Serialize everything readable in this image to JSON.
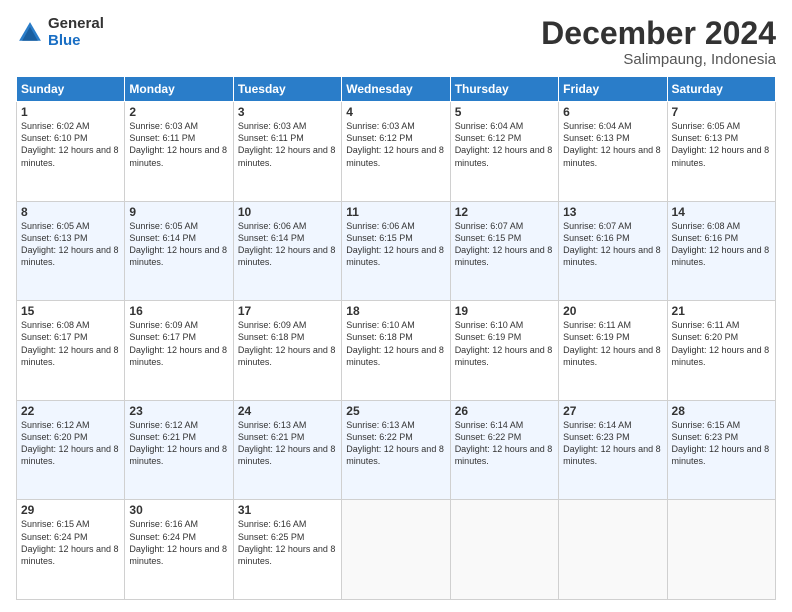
{
  "logo": {
    "general": "General",
    "blue": "Blue"
  },
  "title": "December 2024",
  "location": "Salimpaung, Indonesia",
  "days_of_week": [
    "Sunday",
    "Monday",
    "Tuesday",
    "Wednesday",
    "Thursday",
    "Friday",
    "Saturday"
  ],
  "weeks": [
    [
      {
        "day": "1",
        "sunrise": "6:02 AM",
        "sunset": "6:10 PM",
        "daylight": "12 hours and 8 minutes."
      },
      {
        "day": "2",
        "sunrise": "6:03 AM",
        "sunset": "6:11 PM",
        "daylight": "12 hours and 8 minutes."
      },
      {
        "day": "3",
        "sunrise": "6:03 AM",
        "sunset": "6:11 PM",
        "daylight": "12 hours and 8 minutes."
      },
      {
        "day": "4",
        "sunrise": "6:03 AM",
        "sunset": "6:12 PM",
        "daylight": "12 hours and 8 minutes."
      },
      {
        "day": "5",
        "sunrise": "6:04 AM",
        "sunset": "6:12 PM",
        "daylight": "12 hours and 8 minutes."
      },
      {
        "day": "6",
        "sunrise": "6:04 AM",
        "sunset": "6:13 PM",
        "daylight": "12 hours and 8 minutes."
      },
      {
        "day": "7",
        "sunrise": "6:05 AM",
        "sunset": "6:13 PM",
        "daylight": "12 hours and 8 minutes."
      }
    ],
    [
      {
        "day": "8",
        "sunrise": "6:05 AM",
        "sunset": "6:13 PM",
        "daylight": "12 hours and 8 minutes."
      },
      {
        "day": "9",
        "sunrise": "6:05 AM",
        "sunset": "6:14 PM",
        "daylight": "12 hours and 8 minutes."
      },
      {
        "day": "10",
        "sunrise": "6:06 AM",
        "sunset": "6:14 PM",
        "daylight": "12 hours and 8 minutes."
      },
      {
        "day": "11",
        "sunrise": "6:06 AM",
        "sunset": "6:15 PM",
        "daylight": "12 hours and 8 minutes."
      },
      {
        "day": "12",
        "sunrise": "6:07 AM",
        "sunset": "6:15 PM",
        "daylight": "12 hours and 8 minutes."
      },
      {
        "day": "13",
        "sunrise": "6:07 AM",
        "sunset": "6:16 PM",
        "daylight": "12 hours and 8 minutes."
      },
      {
        "day": "14",
        "sunrise": "6:08 AM",
        "sunset": "6:16 PM",
        "daylight": "12 hours and 8 minutes."
      }
    ],
    [
      {
        "day": "15",
        "sunrise": "6:08 AM",
        "sunset": "6:17 PM",
        "daylight": "12 hours and 8 minutes."
      },
      {
        "day": "16",
        "sunrise": "6:09 AM",
        "sunset": "6:17 PM",
        "daylight": "12 hours and 8 minutes."
      },
      {
        "day": "17",
        "sunrise": "6:09 AM",
        "sunset": "6:18 PM",
        "daylight": "12 hours and 8 minutes."
      },
      {
        "day": "18",
        "sunrise": "6:10 AM",
        "sunset": "6:18 PM",
        "daylight": "12 hours and 8 minutes."
      },
      {
        "day": "19",
        "sunrise": "6:10 AM",
        "sunset": "6:19 PM",
        "daylight": "12 hours and 8 minutes."
      },
      {
        "day": "20",
        "sunrise": "6:11 AM",
        "sunset": "6:19 PM",
        "daylight": "12 hours and 8 minutes."
      },
      {
        "day": "21",
        "sunrise": "6:11 AM",
        "sunset": "6:20 PM",
        "daylight": "12 hours and 8 minutes."
      }
    ],
    [
      {
        "day": "22",
        "sunrise": "6:12 AM",
        "sunset": "6:20 PM",
        "daylight": "12 hours and 8 minutes."
      },
      {
        "day": "23",
        "sunrise": "6:12 AM",
        "sunset": "6:21 PM",
        "daylight": "12 hours and 8 minutes."
      },
      {
        "day": "24",
        "sunrise": "6:13 AM",
        "sunset": "6:21 PM",
        "daylight": "12 hours and 8 minutes."
      },
      {
        "day": "25",
        "sunrise": "6:13 AM",
        "sunset": "6:22 PM",
        "daylight": "12 hours and 8 minutes."
      },
      {
        "day": "26",
        "sunrise": "6:14 AM",
        "sunset": "6:22 PM",
        "daylight": "12 hours and 8 minutes."
      },
      {
        "day": "27",
        "sunrise": "6:14 AM",
        "sunset": "6:23 PM",
        "daylight": "12 hours and 8 minutes."
      },
      {
        "day": "28",
        "sunrise": "6:15 AM",
        "sunset": "6:23 PM",
        "daylight": "12 hours and 8 minutes."
      }
    ],
    [
      {
        "day": "29",
        "sunrise": "6:15 AM",
        "sunset": "6:24 PM",
        "daylight": "12 hours and 8 minutes."
      },
      {
        "day": "30",
        "sunrise": "6:16 AM",
        "sunset": "6:24 PM",
        "daylight": "12 hours and 8 minutes."
      },
      {
        "day": "31",
        "sunrise": "6:16 AM",
        "sunset": "6:25 PM",
        "daylight": "12 hours and 8 minutes."
      },
      null,
      null,
      null,
      null
    ]
  ]
}
